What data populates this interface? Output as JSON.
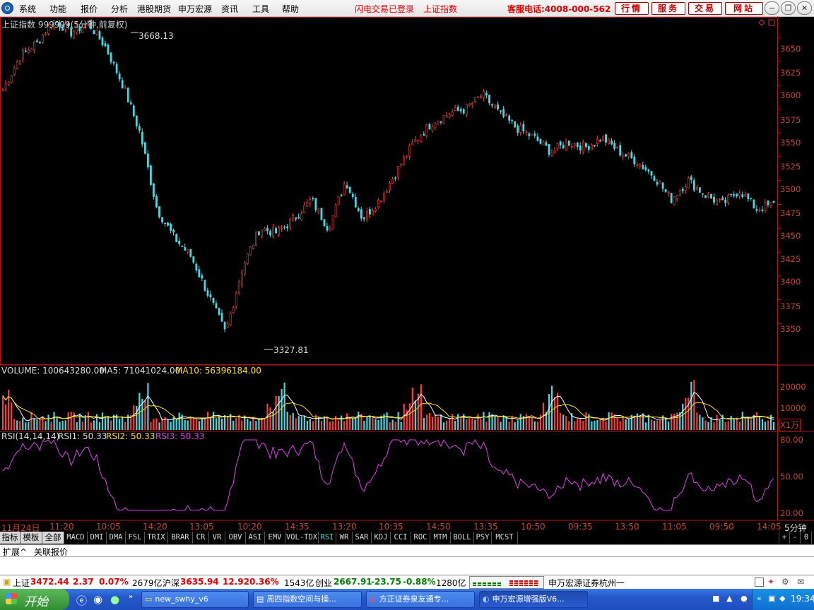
{
  "menu": {
    "items": [
      "系统",
      "功能",
      "报价",
      "分析",
      "港股期货",
      "申万宏源",
      "资讯",
      "工具",
      "帮助"
    ],
    "login_status": "闪电交易已登录",
    "index_name": "上证指数",
    "hotline": "客服电话:4008-000-562",
    "buttons": [
      "行情",
      "服务",
      "交易",
      "网站"
    ],
    "window_controls": [
      "circle-minus",
      "restore",
      "close"
    ]
  },
  "price_chart": {
    "title": "上证指数 999999(5分钟,前复权)",
    "high_label": "3668.13",
    "low_label": "3327.81",
    "y_ticks": [
      "3650",
      "3625",
      "3600",
      "3575",
      "3550",
      "3525",
      "3500",
      "3475",
      "3450",
      "3425",
      "3400",
      "3375",
      "3350"
    ]
  },
  "volume_panel": {
    "label_volume": "VOLUME: 100643280.00",
    "label_ma5": "MA5: 71041024.00",
    "label_ma10": "MA10: 56396184.00",
    "y_ticks": [
      "20000",
      "10000"
    ],
    "unit": "X1万"
  },
  "rsi_panel": {
    "label_rsi": "RSI(14,14,14)",
    "label_rsi1": "RSI1: 50.33",
    "label_rsi2": "RSI2: 50.33",
    "label_rsi3": "RSI3: 50.33",
    "y_ticks": [
      "80.00",
      "50.00",
      "20.00"
    ]
  },
  "x_axis": {
    "ticks": [
      "11月24日",
      "11:20",
      "10:05",
      "14:20",
      "13:05",
      "10:20",
      "14:35",
      "13:20",
      "10:35",
      "14:50",
      "13:35",
      "10:50",
      "09:35",
      "13:50",
      "11:05",
      "09:50",
      "14:05"
    ],
    "period": "5分钟"
  },
  "tabs": [
    "指标",
    "模板",
    "全部",
    "MACD",
    "DMI",
    "DMA",
    "FSL",
    "TRIX",
    "BRAR",
    "CR",
    "VR",
    "OBV",
    "ASI",
    "EMV",
    "VOL-TDX",
    "RSI",
    "WR",
    "SAR",
    "KDJ",
    "CCI",
    "ROC",
    "MTM",
    "BOLL",
    "PSY",
    "MCST"
  ],
  "tab_controls": [
    "+",
    "-",
    "0"
  ],
  "subtabs": [
    "扩展^",
    "关联报价"
  ],
  "status": {
    "sh_label": "上证",
    "sh_value": "3472.44",
    "sh_change": "2.37",
    "sh_pct": "0.07%",
    "sh_amount": "2679亿",
    "hs_label": "沪深",
    "hs_value": "3635.94",
    "hs_change": "12.92",
    "hs_pct": "0.36%",
    "hs_amount": "1543亿",
    "cy_label": "创业",
    "cy_value": "2667.91",
    "cy_change": "-23.75",
    "cy_pct": "-0.88%",
    "cy_amount": "1280亿",
    "broker": "申万宏源证券杭州一"
  },
  "taskbar": {
    "start": "开始",
    "tasks": [
      "new_swhy_v6",
      "周四指数空间与操...",
      "方正证券泉友通专...",
      "申万宏源增强版V6..."
    ],
    "clock": "19:34"
  },
  "chart_data": [
    {
      "type": "candlestick",
      "title": "上证指数 999999(5分钟,前复权)",
      "ylim": [
        3325,
        3670
      ],
      "high_marker": 3668.13,
      "low_marker": 3327.81,
      "approx_close_path": [
        3595,
        3630,
        3645,
        3668,
        3655,
        3665,
        3640,
        3600,
        3550,
        3470,
        3440,
        3420,
        3380,
        3340,
        3410,
        3450,
        3445,
        3460,
        3480,
        3450,
        3500,
        3460,
        3480,
        3510,
        3540,
        3560,
        3570,
        3575,
        3590,
        3570,
        3555,
        3545,
        3530,
        3540,
        3535,
        3545,
        3530,
        3520,
        3505,
        3480,
        3500,
        3485,
        3475,
        3490,
        3470,
        3475
      ]
    },
    {
      "type": "bar",
      "title": "VOLUME",
      "series": [
        {
          "name": "VOLUME",
          "last": 100643280.0
        },
        {
          "name": "MA5",
          "last": 71041024.0
        },
        {
          "name": "MA10",
          "last": 56396184.0
        }
      ],
      "ylim": [
        0,
        25000
      ],
      "unit": "X1万"
    },
    {
      "type": "line",
      "title": "RSI(14,14,14)",
      "series": [
        {
          "name": "RSI1",
          "last": 50.33
        },
        {
          "name": "RSI2",
          "last": 50.33
        },
        {
          "name": "RSI3",
          "last": 50.33
        }
      ],
      "ylim": [
        15,
        85
      ]
    }
  ],
  "colors": {
    "up": "#ff3a3a",
    "down": "#48d8e0",
    "axis": "#c8452a",
    "ma5": "#ffffff",
    "ma10": "#ffe000",
    "rsi": "#e040e8"
  }
}
